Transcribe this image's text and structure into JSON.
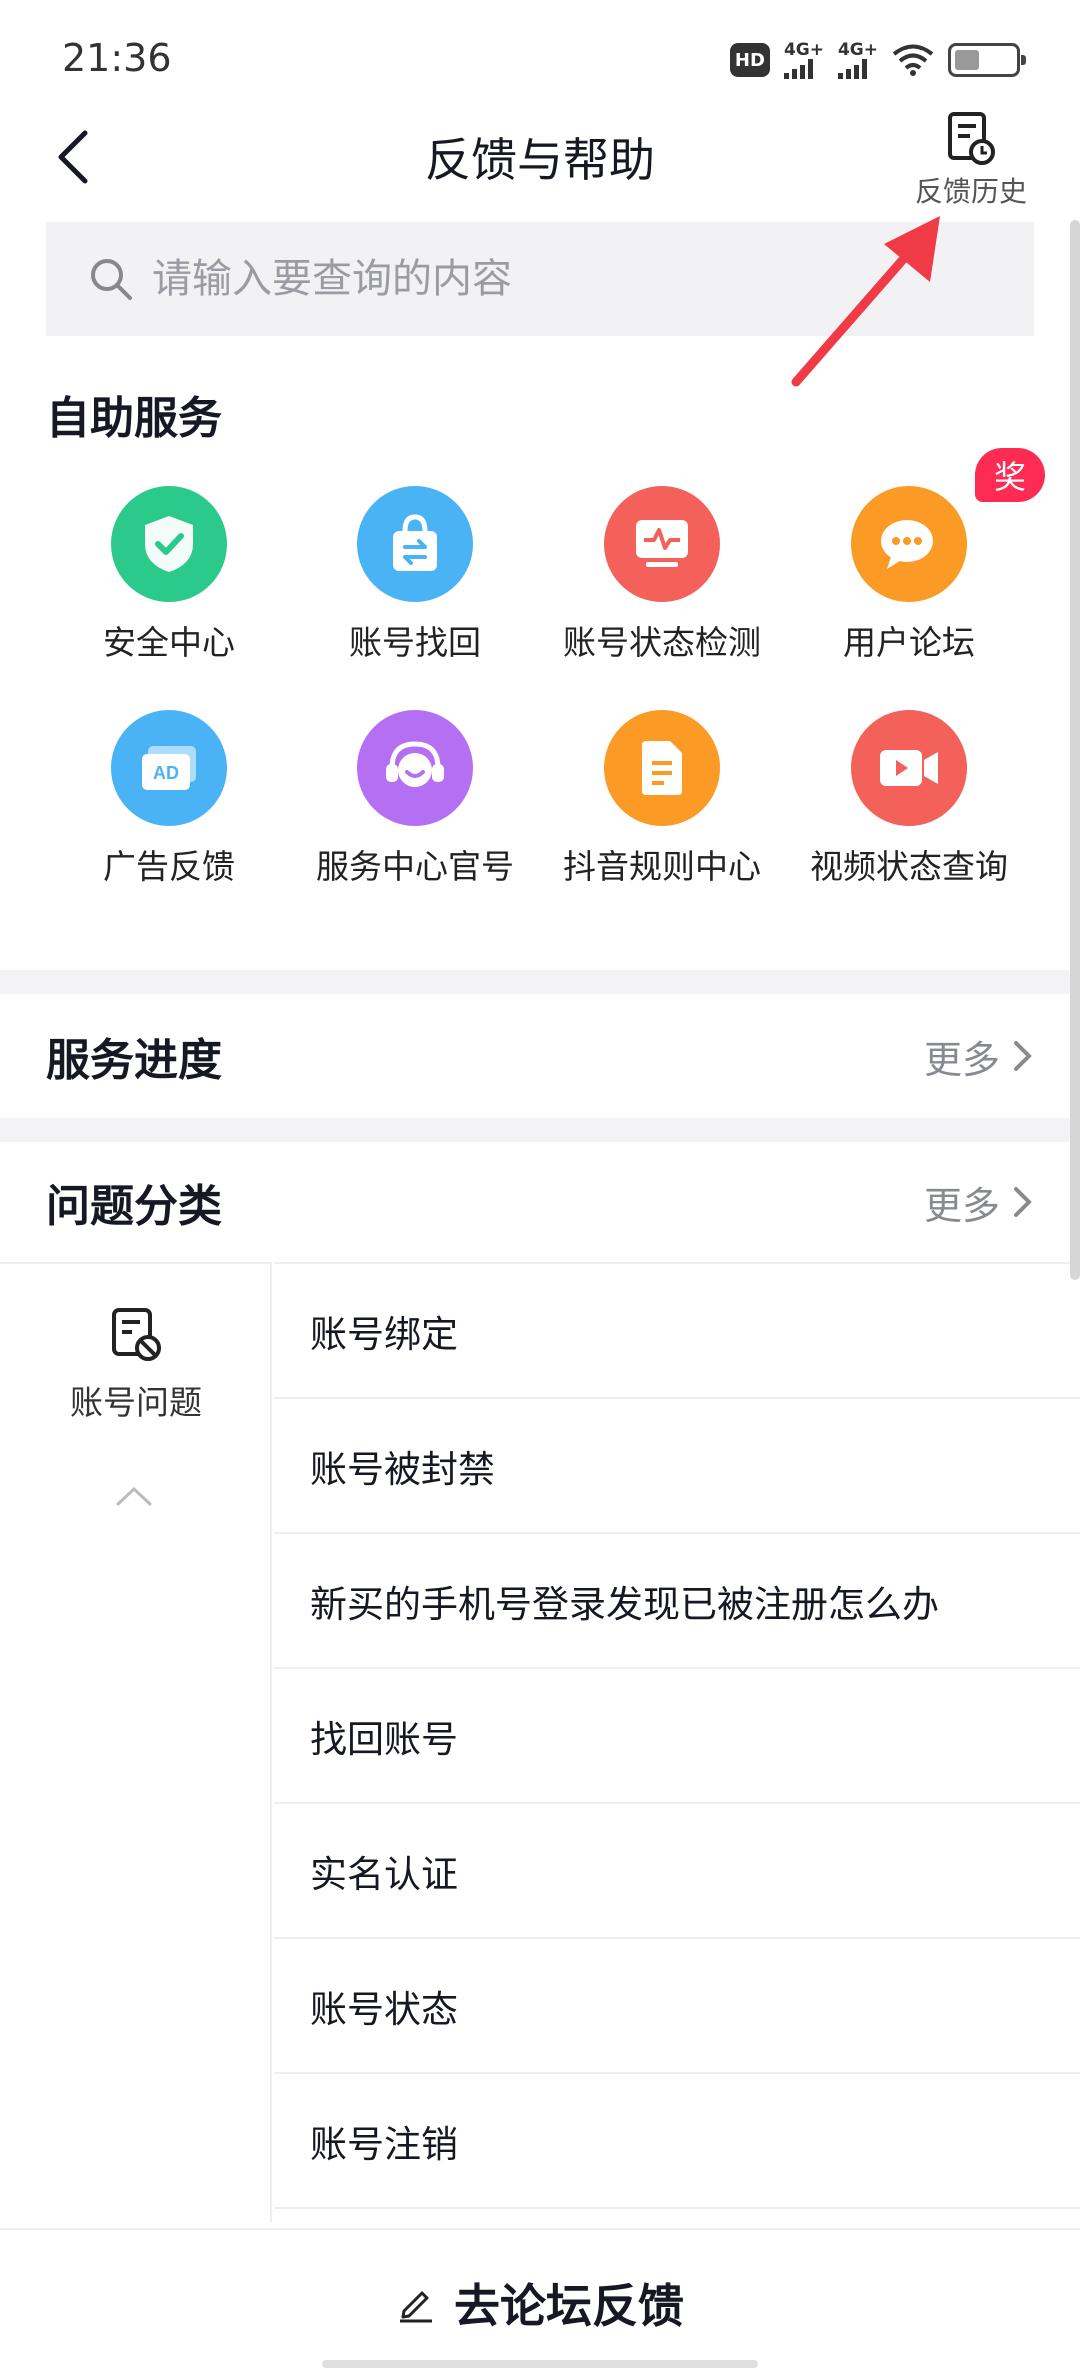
{
  "status_bar": {
    "time": "21:36",
    "hd_label": "HD",
    "net1": "4G+",
    "net2": "4G+",
    "icons": [
      "hd-icon",
      "signal-icon",
      "signal-icon",
      "wifi-icon",
      "battery-icon"
    ]
  },
  "header": {
    "title": "反馈与帮助",
    "history_label": "反馈历史"
  },
  "search": {
    "placeholder": "请输入要查询的内容"
  },
  "self_service": {
    "title": "自助服务",
    "items": [
      {
        "label": "安全中心",
        "icon": "shield-icon",
        "color": "#2bc98a"
      },
      {
        "label": "账号找回",
        "icon": "bag-icon",
        "color": "#49b3f5"
      },
      {
        "label": "账号状态检测",
        "icon": "monitor-pulse-icon",
        "color": "#f4605a"
      },
      {
        "label": "用户论坛",
        "icon": "chat-bubble-icon",
        "color": "#fb9a24",
        "badge": "奖"
      },
      {
        "label": "广告反馈",
        "icon": "ad-icon",
        "color": "#49b3f5"
      },
      {
        "label": "服务中心官号",
        "icon": "headset-icon",
        "color": "#b56ff2"
      },
      {
        "label": "抖音规则中心",
        "icon": "document-icon",
        "color": "#fb9a24"
      },
      {
        "label": "视频状态查询",
        "icon": "video-icon",
        "color": "#f4605a"
      }
    ]
  },
  "progress": {
    "title": "服务进度",
    "more_label": "更多"
  },
  "categories": {
    "title": "问题分类",
    "more_label": "更多",
    "selected": {
      "label": "账号问题",
      "icon": "account-issue-icon"
    },
    "items": [
      "账号绑定",
      "账号被封禁",
      "新买的手机号登录发现已被注册怎么办",
      "找回账号",
      "实名认证",
      "账号状态",
      "账号注销"
    ]
  },
  "bottom": {
    "label": "去论坛反馈",
    "icon": "pencil-icon"
  },
  "colors": {
    "annotation_arrow": "#f03a45",
    "badge": "#fe2c55"
  }
}
